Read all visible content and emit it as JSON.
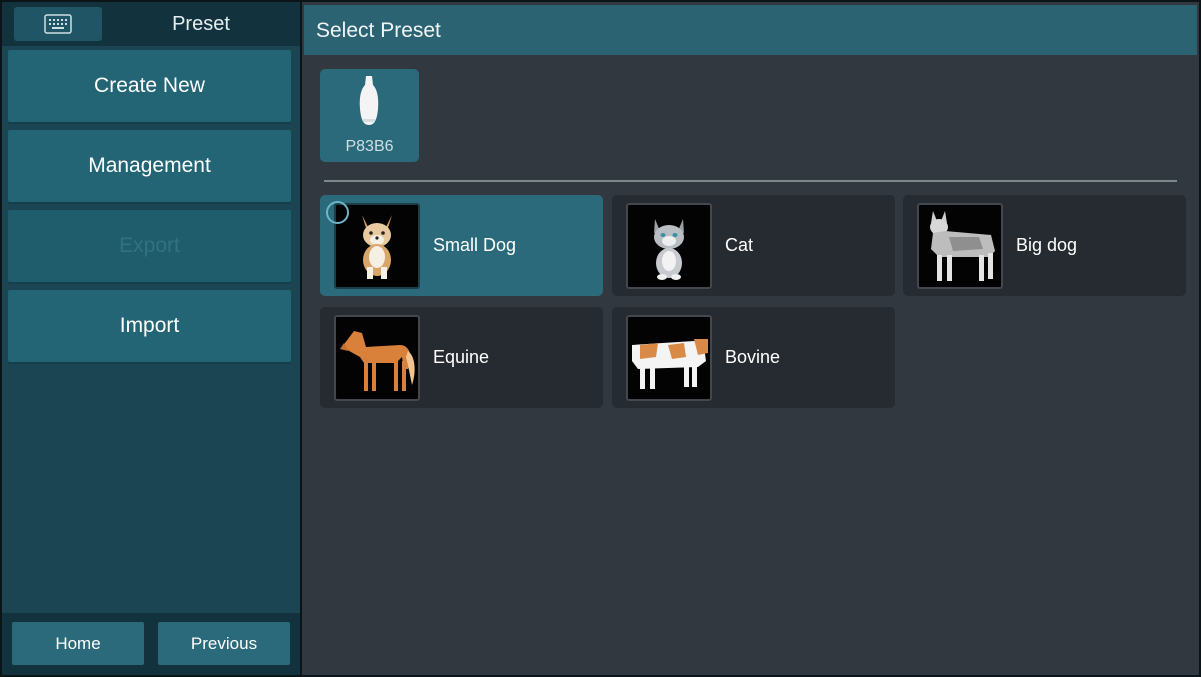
{
  "sidebar": {
    "keyboard_icon": "keyboard-icon",
    "title": "Preset",
    "menu": [
      {
        "label": "Create New",
        "enabled": true
      },
      {
        "label": "Management",
        "enabled": true
      },
      {
        "label": "Export",
        "enabled": false
      },
      {
        "label": "Import",
        "enabled": true
      }
    ],
    "footer": {
      "home_label": "Home",
      "previous_label": "Previous"
    }
  },
  "main": {
    "title": "Select Preset",
    "probe": {
      "label": "P83B6",
      "icon": "probe-icon"
    },
    "presets": [
      {
        "label": "Small Dog",
        "icon": "small-dog-icon",
        "selected": true
      },
      {
        "label": "Cat",
        "icon": "cat-icon",
        "selected": false
      },
      {
        "label": "Big dog",
        "icon": "big-dog-icon",
        "selected": false
      },
      {
        "label": "Equine",
        "icon": "horse-icon",
        "selected": false
      },
      {
        "label": "Bovine",
        "icon": "cow-icon",
        "selected": false
      }
    ]
  },
  "colors": {
    "sidebar_bg": "#1b4553",
    "main_bg": "#32383f",
    "accent": "#2b6a7a",
    "header_bg": "#2c6373"
  }
}
